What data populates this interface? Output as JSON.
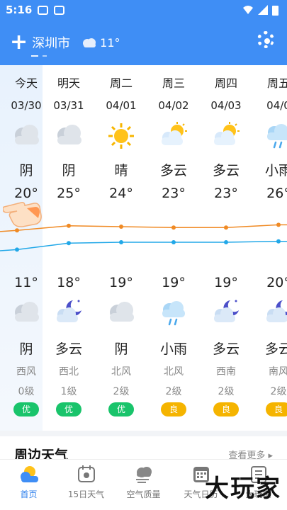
{
  "status": {
    "time": "5:16"
  },
  "header": {
    "city": "深圳市",
    "temp": "11°"
  },
  "days": [
    {
      "day": "今天",
      "date": "03/30",
      "wx_day": "阴",
      "icon_day": "cloudy-icon",
      "hi": "20°",
      "lo": "11°",
      "wx_night": "阴",
      "icon_night": "cloudy-icon",
      "wind_dir": "西风",
      "wind_lv": "0级",
      "aq": "优",
      "aq_color": "#19c46b"
    },
    {
      "day": "明天",
      "date": "03/31",
      "wx_day": "阴",
      "icon_day": "cloudy-icon",
      "hi": "25°",
      "lo": "18°",
      "wx_night": "多云",
      "icon_night": "moon-cloud-icon",
      "wind_dir": "西北",
      "wind_lv": "1级",
      "aq": "优",
      "aq_color": "#19c46b"
    },
    {
      "day": "周二",
      "date": "04/01",
      "wx_day": "晴",
      "icon_day": "sun-icon",
      "hi": "24°",
      "lo": "19°",
      "wx_night": "阴",
      "icon_night": "cloudy-icon",
      "wind_dir": "北风",
      "wind_lv": "2级",
      "aq": "优",
      "aq_color": "#19c46b"
    },
    {
      "day": "周三",
      "date": "04/02",
      "wx_day": "多云",
      "icon_day": "sun-cloud-icon",
      "hi": "23°",
      "lo": "19°",
      "wx_night": "小雨",
      "icon_night": "rain-icon",
      "wind_dir": "北风",
      "wind_lv": "2级",
      "aq": "良",
      "aq_color": "#f5b400"
    },
    {
      "day": "周四",
      "date": "04/03",
      "wx_day": "多云",
      "icon_day": "sun-cloud-icon",
      "hi": "23°",
      "lo": "19°",
      "wx_night": "多云",
      "icon_night": "moon-cloud-icon",
      "wind_dir": "西南",
      "wind_lv": "2级",
      "aq": "良",
      "aq_color": "#f5b400"
    },
    {
      "day": "周五",
      "date": "04/0",
      "wx_day": "小雨",
      "icon_day": "rain-icon",
      "hi": "26°",
      "lo": "20°",
      "wx_night": "多云",
      "icon_night": "moon-cloud-icon",
      "wind_dir": "南风",
      "wind_lv": "2级",
      "aq": "良",
      "aq_color": "#f5b400"
    }
  ],
  "nearby": {
    "title": "周边天气",
    "more": "查看更多"
  },
  "nav": [
    {
      "label": "首页",
      "icon": "home-weather-icon"
    },
    {
      "label": "15日天气",
      "icon": "calendar-15-icon"
    },
    {
      "label": "空气质量",
      "icon": "air-quality-icon"
    },
    {
      "label": "天气日历",
      "icon": "calendar-icon"
    },
    {
      "label": "大玩家",
      "icon": "almanac-icon"
    }
  ],
  "watermark": "大玩家",
  "colors": {
    "brand": "#3f8ef5",
    "hi_line": "#f08a24",
    "lo_line": "#22a8e8"
  }
}
